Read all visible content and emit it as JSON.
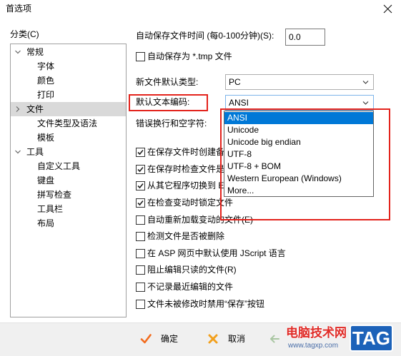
{
  "window": {
    "title": "首选项"
  },
  "category": {
    "label": "分类(C)",
    "tree": [
      {
        "label": "常规",
        "expanded": true,
        "selected": false,
        "children": [
          "字体",
          "颜色",
          "打印"
        ]
      },
      {
        "label": "文件",
        "expanded": true,
        "selected": true,
        "children": [
          "文件类型及语法",
          "模板"
        ]
      },
      {
        "label": "工具",
        "expanded": true,
        "selected": false,
        "children": [
          "自定义工具",
          "键盘",
          "拼写检查",
          "工具栏",
          "布局"
        ]
      }
    ]
  },
  "settings": {
    "autosave_interval": {
      "label": "自动保存文件时间 (每0-100分钟)(S):",
      "value": "0.0"
    },
    "autosave_tmp": {
      "label": "自动保存为 *.tmp 文件",
      "checked": false
    },
    "new_file_type": {
      "label": "新文件默认类型:",
      "value": "PC"
    },
    "default_encoding": {
      "label": "默认文本编码:",
      "value": "ANSI",
      "open": true,
      "options": [
        {
          "label": "ANSI",
          "highlighted": true
        },
        {
          "label": "Unicode",
          "highlighted": false
        },
        {
          "label": "Unicode big endian",
          "highlighted": false
        },
        {
          "label": "UTF-8",
          "highlighted": false
        },
        {
          "label": "UTF-8 + BOM",
          "highlighted": false
        },
        {
          "label": "Western European (Windows)",
          "highlighted": false
        },
        {
          "label": "More...",
          "highlighted": false
        }
      ]
    },
    "line_break": {
      "label": "错误换行和空字符:"
    },
    "options": [
      {
        "label": "在保存文件时创建备",
        "checked": true
      },
      {
        "label": "在保存时检查文件是",
        "checked": true
      },
      {
        "label": "从其它程序切换到 E",
        "checked": true
      },
      {
        "label": "在检查变动时锁定文件",
        "checked": true
      },
      {
        "label": "自动重新加载变动的文件(E)",
        "checked": false
      },
      {
        "label": "检测文件是否被删除",
        "checked": false
      },
      {
        "label": "在 ASP 网页中默认使用 JScript 语言",
        "checked": false
      },
      {
        "label": "阻止编辑只读的文件(R)",
        "checked": false
      },
      {
        "label": "不记录最近编辑的文件",
        "checked": false
      },
      {
        "label": "文件未被修改时禁用“保存”按钮",
        "checked": false
      }
    ]
  },
  "buttons": {
    "ok": "确定",
    "cancel": "取消"
  },
  "watermark": {
    "site_name": "电脑技术网",
    "badge": "TAG",
    "url": "www.tagxp.com"
  },
  "colors": {
    "selection": "#0078d7",
    "annotation_red": "#e3231c",
    "tree_selected": "#d9d9d9",
    "ok_icon": "#f26b1d",
    "cancel_icon": "#f2a01d",
    "watermark_red": "#e02b27",
    "watermark_blue": "#1c62b9"
  }
}
